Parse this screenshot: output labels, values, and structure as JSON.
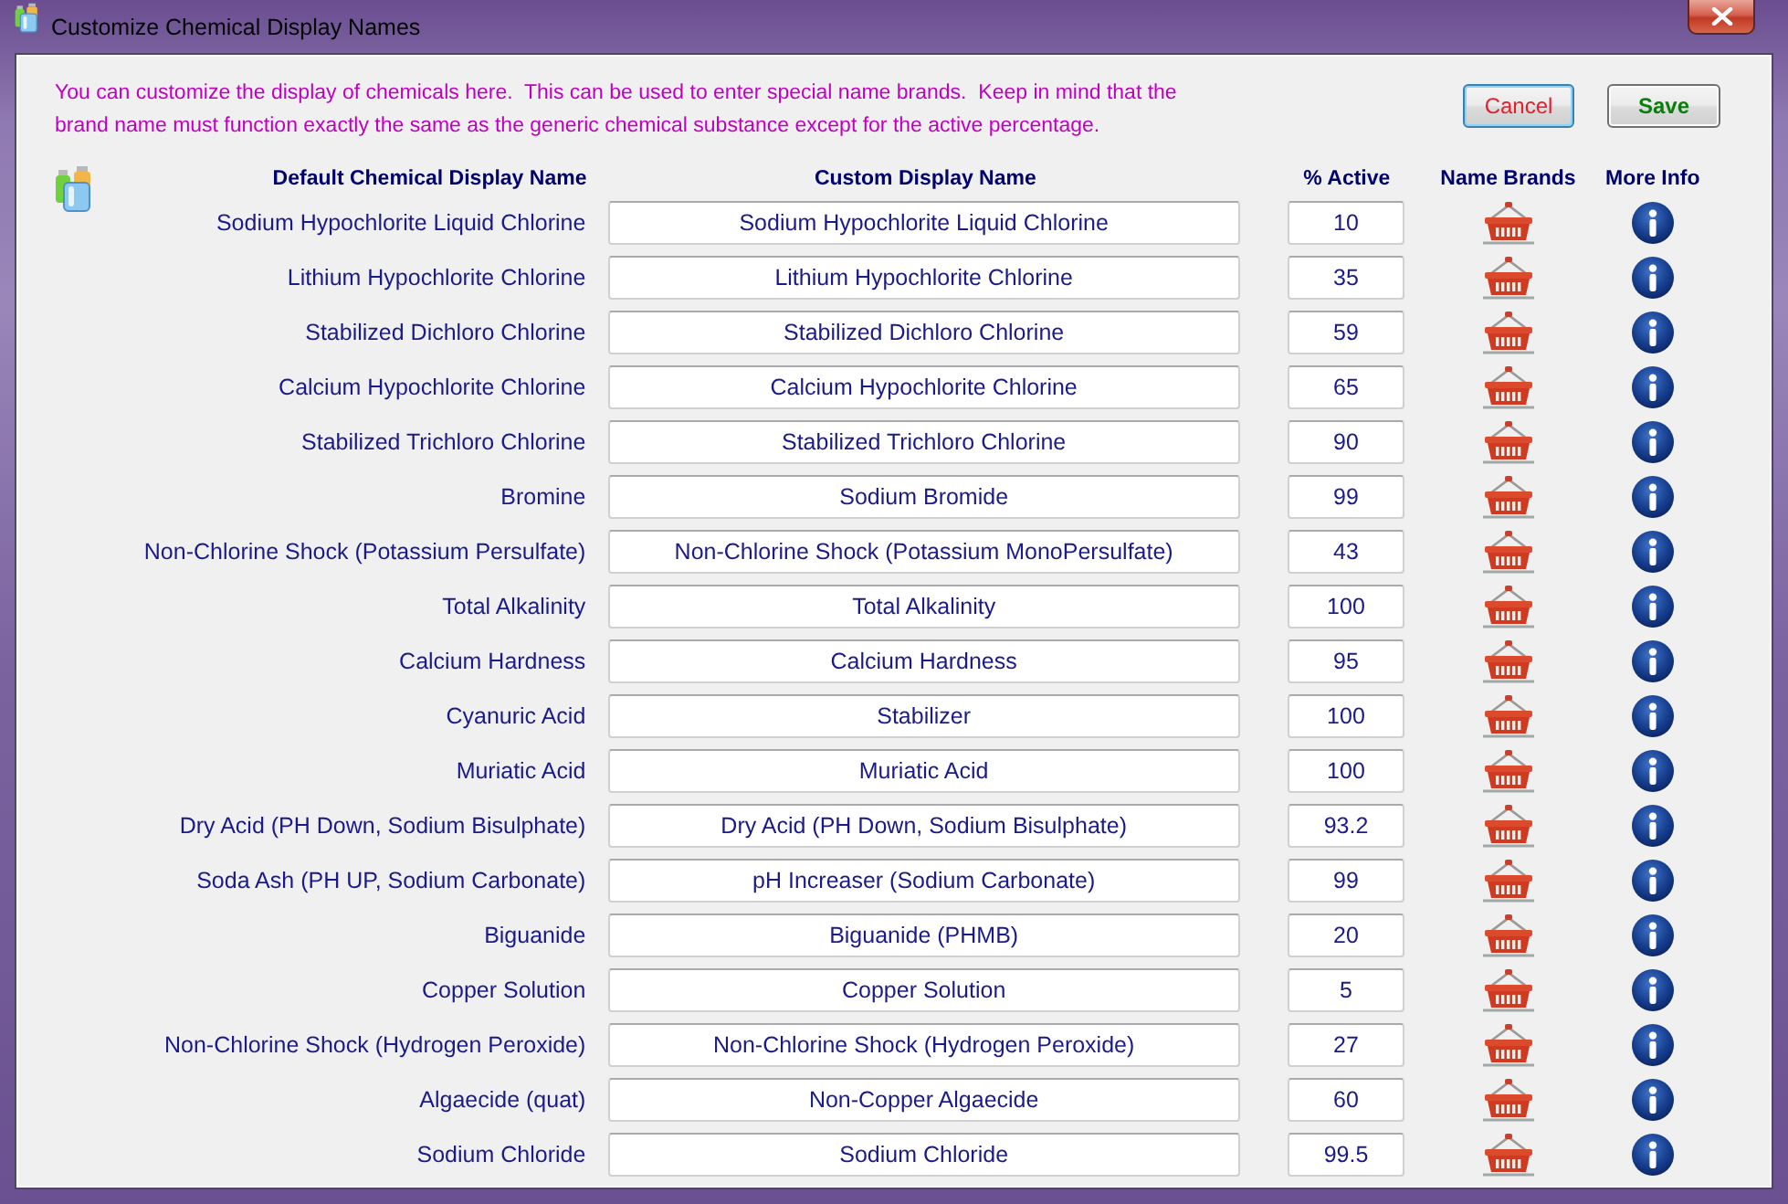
{
  "window": {
    "title": "Customize Chemical Display Names"
  },
  "message_lines": [
    "You can customize the display of chemicals here.  This can be used to enter special name brands.  Keep in mind that the",
    "brand name must function exactly the same as the generic chemical substance except for the active percentage."
  ],
  "buttons": [
    {
      "label": "Cancel",
      "kind": "cancel",
      "focused": true
    },
    {
      "label": "Save",
      "kind": "save",
      "focused": false
    }
  ],
  "columns": [
    "Default Chemical Display Name",
    "Custom Display Name",
    "% Active",
    "Name Brands",
    "More Info"
  ],
  "rows": [
    {
      "default_name": "Sodium Hypochlorite Liquid Chlorine",
      "custom_name": "Sodium Hypochlorite Liquid Chlorine",
      "active": "10"
    },
    {
      "default_name": "Lithium Hypochlorite Chlorine",
      "custom_name": "Lithium Hypochlorite Chlorine",
      "active": "35"
    },
    {
      "default_name": "Stabilized Dichloro Chlorine",
      "custom_name": "Stabilized Dichloro Chlorine",
      "active": "59"
    },
    {
      "default_name": "Calcium Hypochlorite Chlorine",
      "custom_name": "Calcium Hypochlorite Chlorine",
      "active": "65"
    },
    {
      "default_name": "Stabilized Trichloro Chlorine",
      "custom_name": "Stabilized Trichloro Chlorine",
      "active": "90"
    },
    {
      "default_name": "Bromine",
      "custom_name": "Sodium Bromide",
      "active": "99"
    },
    {
      "default_name": "Non-Chlorine Shock (Potassium Persulfate)",
      "custom_name": "Non-Chlorine Shock (Potassium MonoPersulfate)",
      "active": "43"
    },
    {
      "default_name": "Total Alkalinity",
      "custom_name": "Total Alkalinity",
      "active": "100"
    },
    {
      "default_name": "Calcium Hardness",
      "custom_name": "Calcium Hardness",
      "active": "95"
    },
    {
      "default_name": "Cyanuric Acid",
      "custom_name": "Stabilizer",
      "active": "100"
    },
    {
      "default_name": "Muriatic Acid",
      "custom_name": "Muriatic Acid",
      "active": "100"
    },
    {
      "default_name": "Dry Acid (PH Down, Sodium Bisulphate)",
      "custom_name": "Dry Acid (PH Down, Sodium Bisulphate)",
      "active": "93.2"
    },
    {
      "default_name": "Soda Ash (PH UP, Sodium Carbonate)",
      "custom_name": "pH Increaser (Sodium Carbonate)",
      "active": "99"
    },
    {
      "default_name": "Biguanide",
      "custom_name": "Biguanide (PHMB)",
      "active": "20"
    },
    {
      "default_name": "Copper Solution",
      "custom_name": "Copper Solution",
      "active": "5"
    },
    {
      "default_name": "Non-Chlorine Shock (Hydrogen Peroxide)",
      "custom_name": "Non-Chlorine Shock (Hydrogen Peroxide)",
      "active": "27"
    },
    {
      "default_name": "Algaecide (quat)",
      "custom_name": "Non-Copper Algaecide",
      "active": "60"
    },
    {
      "default_name": "Sodium Chloride",
      "custom_name": "Sodium Chloride",
      "active": "99.5"
    }
  ]
}
